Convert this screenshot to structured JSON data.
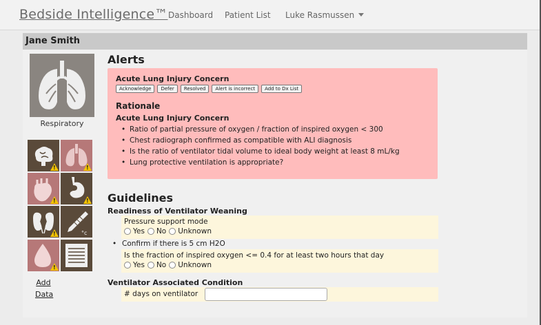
{
  "app": {
    "brand": "Bedside Intelligence™"
  },
  "nav": {
    "dashboard": "Dashboard",
    "patient_list": "Patient List",
    "user": "Luke Rasmussen"
  },
  "patient": {
    "name": "Jane Smith"
  },
  "sidebar": {
    "main_organ_label": "Respiratory",
    "tiles": [
      {
        "icon": "brain-icon",
        "warning": true
      },
      {
        "icon": "lungs-icon",
        "warning": true
      },
      {
        "icon": "heart-icon",
        "warning": true
      },
      {
        "icon": "stomach-icon",
        "warning": true
      },
      {
        "icon": "kidneys-icon",
        "warning": true
      },
      {
        "icon": "thermometer-icon",
        "warning": false
      },
      {
        "icon": "blood-drop-icon",
        "warning": true
      },
      {
        "icon": "notes-icon",
        "warning": false
      }
    ],
    "add_data_line1": "Add",
    "add_data_line2": "Data"
  },
  "alerts": {
    "heading": "Alerts",
    "alert_title": "Acute Lung Injury Concern",
    "buttons": {
      "acknowledge": "Acknowledge",
      "defer": "Defer",
      "resolved": "Resolved",
      "incorrect": "Alert is incorrect",
      "add_dx": "Add to Dx List"
    },
    "rationale_heading": "Rationale",
    "rationale_title": "Acute Lung Injury Concern",
    "rationale_items": [
      "Ratio of partial pressure of oxygen / fraction of inspired oxygen < 300",
      "Chest radiograph confirmed as compatible with ALI diagnosis",
      "Is the ratio of ventilator tidal volume to ideal body weight at least 8 mL/kg",
      "Lung protective ventilation is appropriate?"
    ]
  },
  "guidelines": {
    "heading": "Guidelines",
    "weaning_title": "Readiness of Ventilator Weaning",
    "q1_text": "Pressure support mode",
    "bullet_text": "Confirm if there is 5 cm H2O",
    "q2_text": "Is the fraction of inspired oxygen <= 0.4 for at least two hours that day",
    "options": {
      "yes": "Yes",
      "no": "No",
      "unknown": "Unknown"
    },
    "vac_title": "Ventilator Associated Condition",
    "days_label": "# days on ventilator",
    "days_value": ""
  },
  "colors": {
    "alert_bg": "#ffbcbc",
    "guideline_bg": "#fdf6dc",
    "warning": "#f2c200",
    "tile_brown": "#5a4a3a",
    "tile_pink": "#b67878"
  }
}
